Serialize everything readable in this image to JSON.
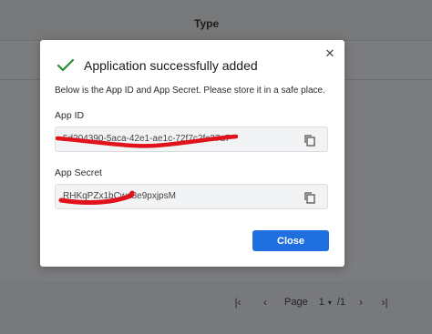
{
  "background": {
    "table": {
      "column_type": "Type"
    },
    "pagination": {
      "first_icon": "first-page-icon",
      "prev_icon": "prev-page-icon",
      "page_label": "Page",
      "page_value": "1",
      "total": "/1",
      "next_icon": "next-page-icon",
      "last_icon": "last-page-icon"
    }
  },
  "modal": {
    "title": "Application successfully added",
    "title_icon": "check-icon",
    "description": "Below is the App ID and App Secret. Please store it in a safe place.",
    "close_icon": "close-icon",
    "fields": [
      {
        "label": "App ID",
        "value": "5d204390-5aca-42e1-ae1c-72f7c2fc37a7",
        "copy_icon": "copy-icon"
      },
      {
        "label": "App Secret",
        "value": "RHKqPZx1bCwa8e9pxjpsM",
        "copy_icon": "copy-icon"
      }
    ],
    "close_button": "Close"
  },
  "colors": {
    "accent": "#1f6fe0",
    "success": "#2e8b3a",
    "redaction": "#e0121b",
    "overlay": "#7b7c7e"
  }
}
